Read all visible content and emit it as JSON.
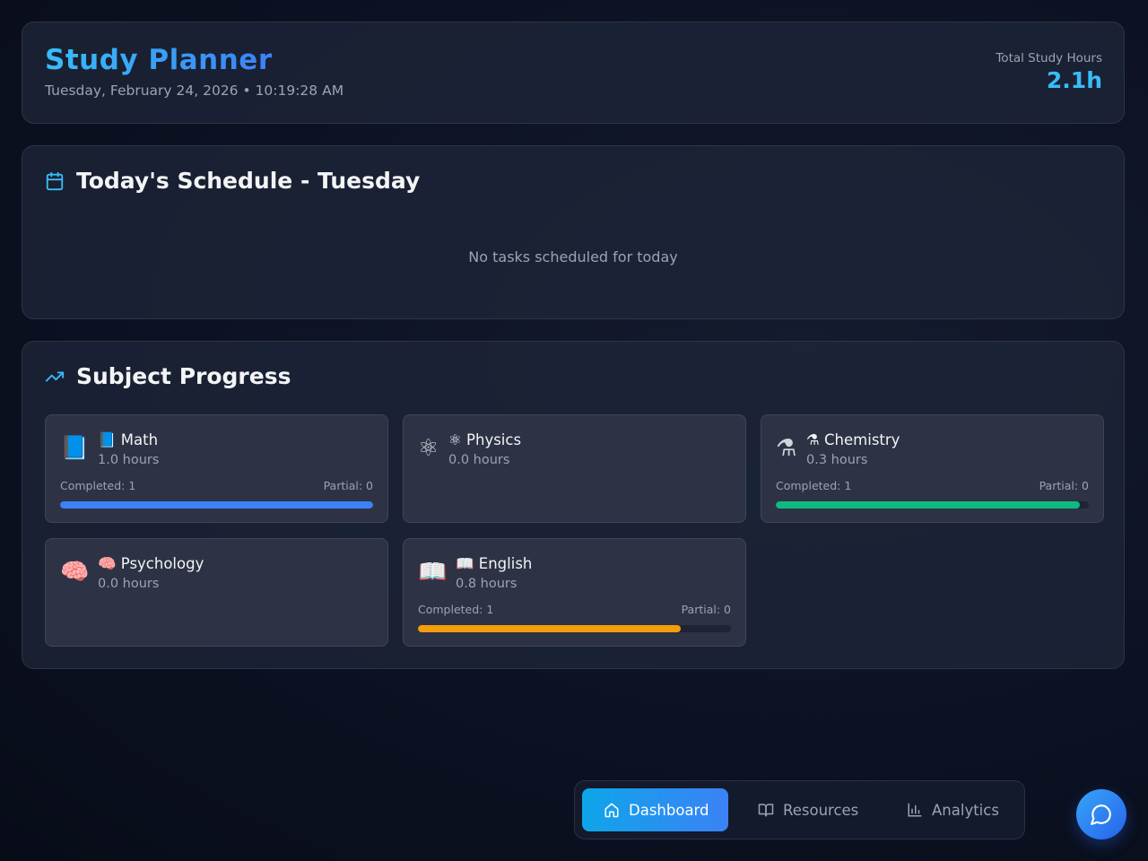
{
  "header": {
    "title": "Study Planner",
    "datetime": "Tuesday, February 24, 2026 • 10:19:28 AM",
    "total_hours_label": "Total Study Hours",
    "total_hours_value": "2.1h"
  },
  "schedule": {
    "title": "Today's Schedule - Tuesday",
    "icon": "calendar-icon",
    "empty_message": "No tasks scheduled for today"
  },
  "progress": {
    "title": "Subject Progress",
    "icon": "trending-up-icon",
    "subjects": [
      {
        "emoji": "📘",
        "name": "📘 Math",
        "hours": "1.0 hours",
        "has_progress": true,
        "completed": "Completed: 1",
        "partial": "Partial: 0",
        "bar_fraction": 1.0,
        "color": "#3b82f6"
      },
      {
        "emoji": "⚛",
        "name": "⚛ Physics",
        "hours": "0.0 hours",
        "has_progress": false
      },
      {
        "emoji": "⚗",
        "name": "⚗ Chemistry",
        "hours": "0.3 hours",
        "has_progress": true,
        "completed": "Completed: 1",
        "partial": "Partial: 0",
        "bar_fraction": 0.97,
        "color": "#10b981"
      },
      {
        "emoji": "🧠",
        "name": "🧠 Psychology",
        "hours": "0.0 hours",
        "has_progress": false
      },
      {
        "emoji": "📖",
        "name": "📖 English",
        "hours": "0.8 hours",
        "has_progress": true,
        "completed": "Completed: 1",
        "partial": "Partial: 0",
        "bar_fraction": 0.84,
        "color": "#f59e0b"
      }
    ]
  },
  "nav": {
    "items": [
      {
        "label": "Dashboard",
        "icon": "home-icon",
        "active": true
      },
      {
        "label": "Resources",
        "icon": "book-open-icon",
        "active": false
      },
      {
        "label": "Analytics",
        "icon": "bar-chart-icon",
        "active": false
      }
    ]
  },
  "chat_button": {
    "icon": "chat-bubble-icon"
  },
  "colors": {
    "accent": "#38bdf8",
    "accent_gradient_end": "#3b82f6",
    "panel_bg": "#1e2538",
    "card_bg": "#2d3344"
  }
}
